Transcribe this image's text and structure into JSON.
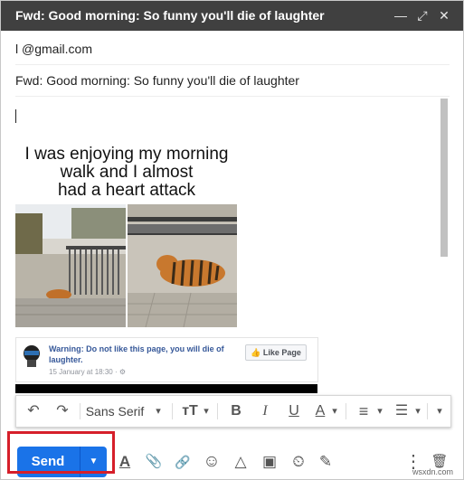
{
  "window": {
    "title": "Fwd: Good morning: So funny you'll die of laughter",
    "minimize_glyph": "—",
    "expand_glyph": "⤢",
    "close_glyph": "✕"
  },
  "compose": {
    "to_value": "l              @gmail.com",
    "subject_value": "Fwd: Good morning: So funny you'll die of laughter"
  },
  "meme": {
    "caption_line1": "I was enjoying my morning",
    "caption_line2": "walk and I almost",
    "caption_line3": "had a heart attack"
  },
  "fb_card": {
    "title": "Warning: Do not like this page, you will die of laughter.",
    "date": "15 January at 18:30 · ⚙",
    "like_button": "👍 Like Page"
  },
  "format_toolbar": {
    "undo_icon": "↶",
    "redo_icon": "↷",
    "font_name": "Sans Serif",
    "font_dropdown": "▾",
    "size_icon": "ᴛT",
    "bold": "B",
    "italic": "I",
    "underline": "U",
    "text_color": "A",
    "align_icon": "≡",
    "list_icon": "☰",
    "more": "▾"
  },
  "bottom_toolbar": {
    "send_label": "Send",
    "send_options_glyph": "▼",
    "formatting_icon": "A",
    "attach_icon": "📎",
    "link_icon": "🔗",
    "emoji_icon": "☺",
    "drive_icon": "△",
    "photo_icon": "▣",
    "confidential_icon": "⏲",
    "signature_icon": "✎",
    "more_icon": "⋮",
    "delete_icon": "🗑"
  },
  "watermark": "wsxdn.com",
  "colors": {
    "titlebar": "#404040",
    "send_button": "#1a73e8",
    "highlight_box": "#d61f2a",
    "fb_link": "#365899"
  }
}
